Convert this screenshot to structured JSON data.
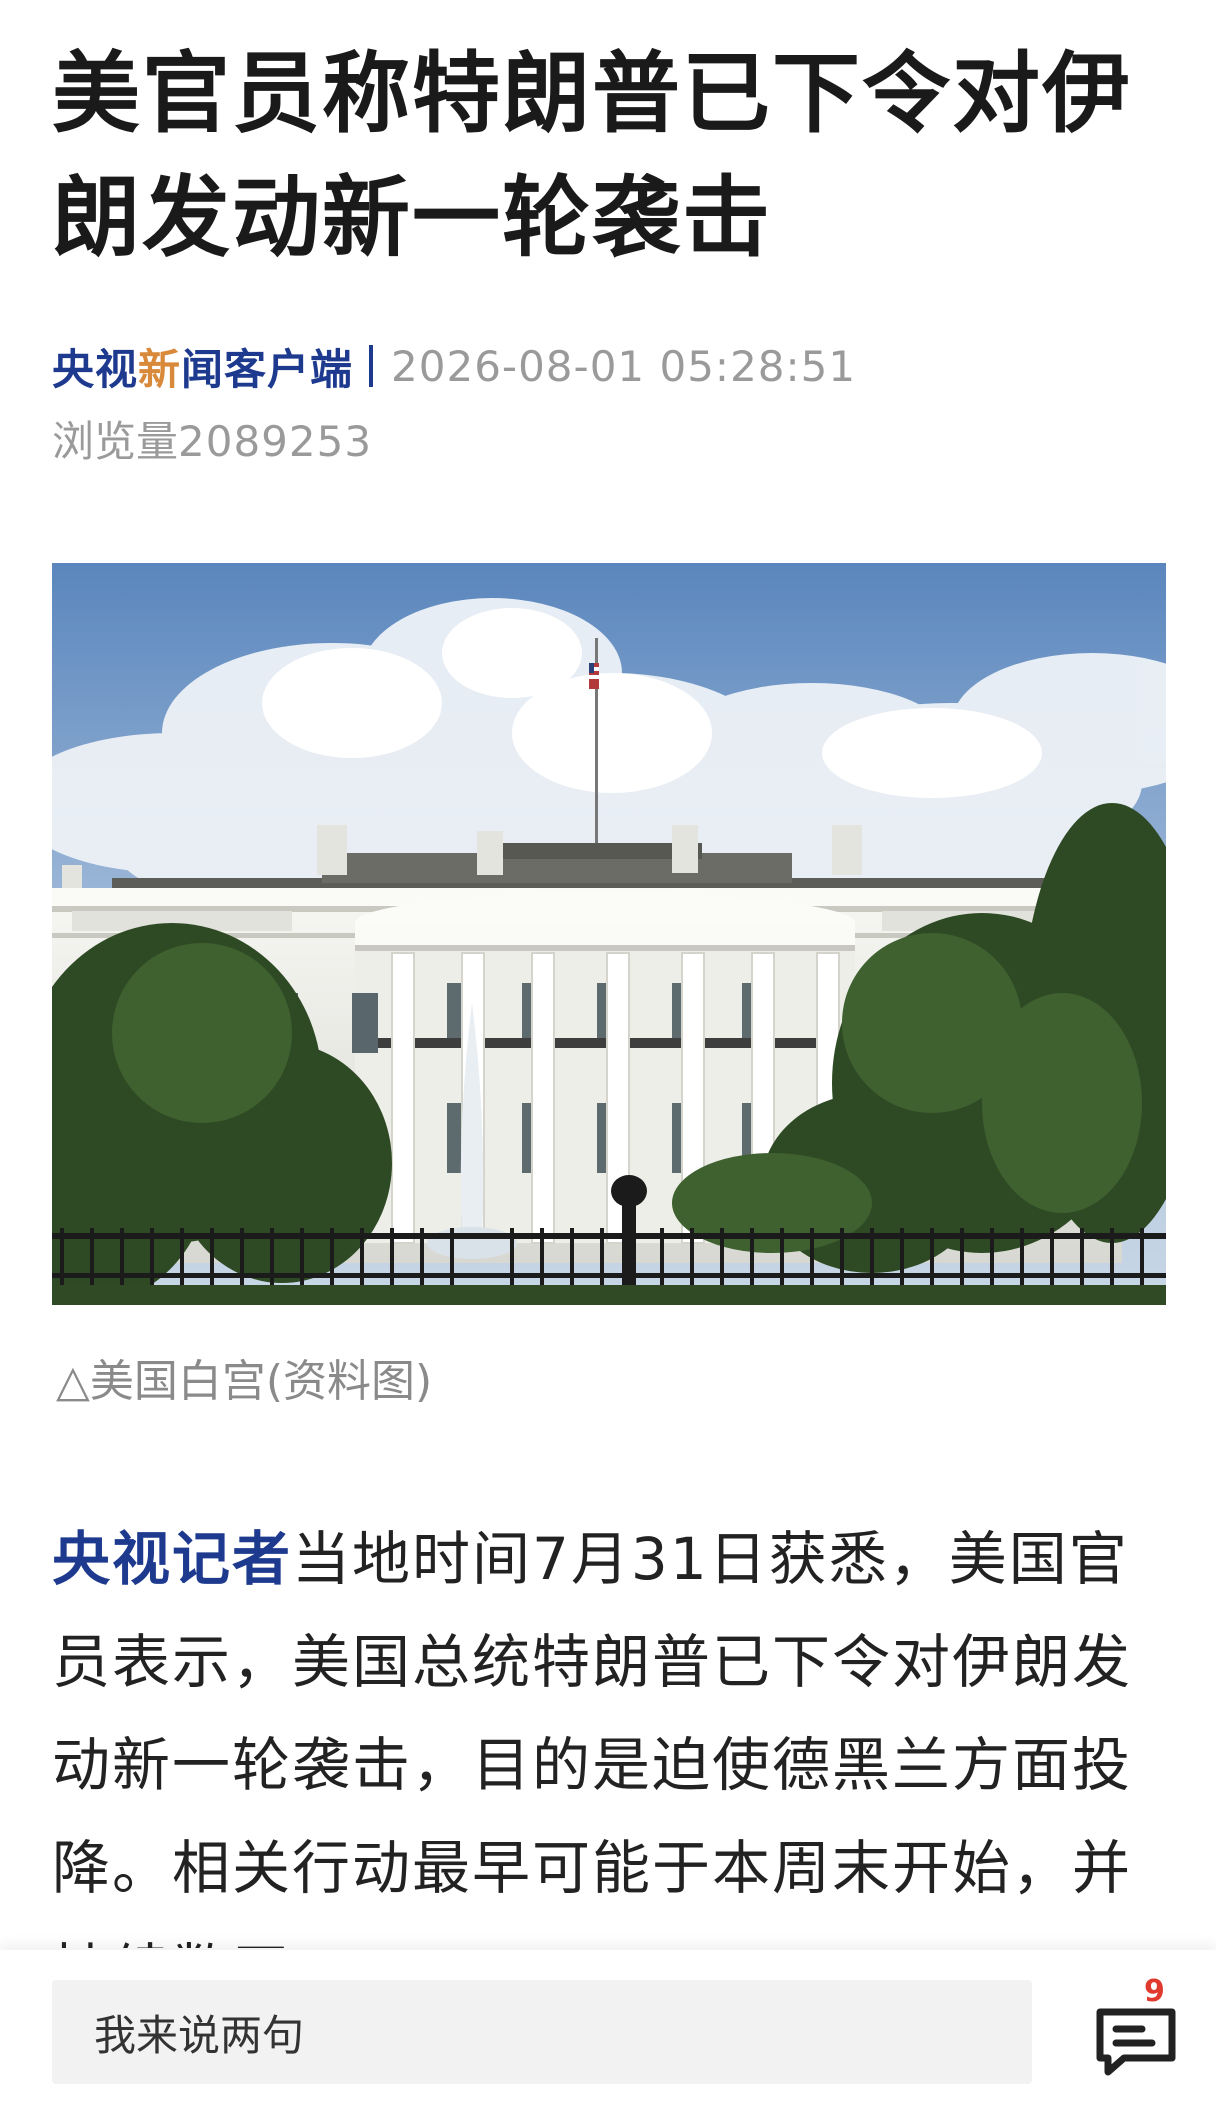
{
  "article": {
    "headline": "美官员称特朗普已下令对伊朗发动新一轮袭击",
    "source": {
      "name_part1": "央视",
      "name_accent": "新",
      "name_part2": "闻客户端",
      "brand_color": "#1d3a8f",
      "accent_color": "#d9893a"
    },
    "timestamp": "2026-08-01 05:28:51",
    "views_label": "浏览量",
    "views_count": "2089253",
    "image": {
      "caption": "△美国白宫(资料图)"
    },
    "body": {
      "lead": "央视记者",
      "text": "当地时间7月31日获悉，美国官员表示，美国总统特朗普已下令对伊朗发动新一轮袭击，目的是迫使德黑兰方面投降。相关行动最早可能于本周末开始，并持续数天"
    }
  },
  "bottom_bar": {
    "comment_placeholder": "我来说两句",
    "comment_icon": "comment-bubble-icon",
    "comment_count": "9",
    "badge_color": "#e03a2f"
  }
}
